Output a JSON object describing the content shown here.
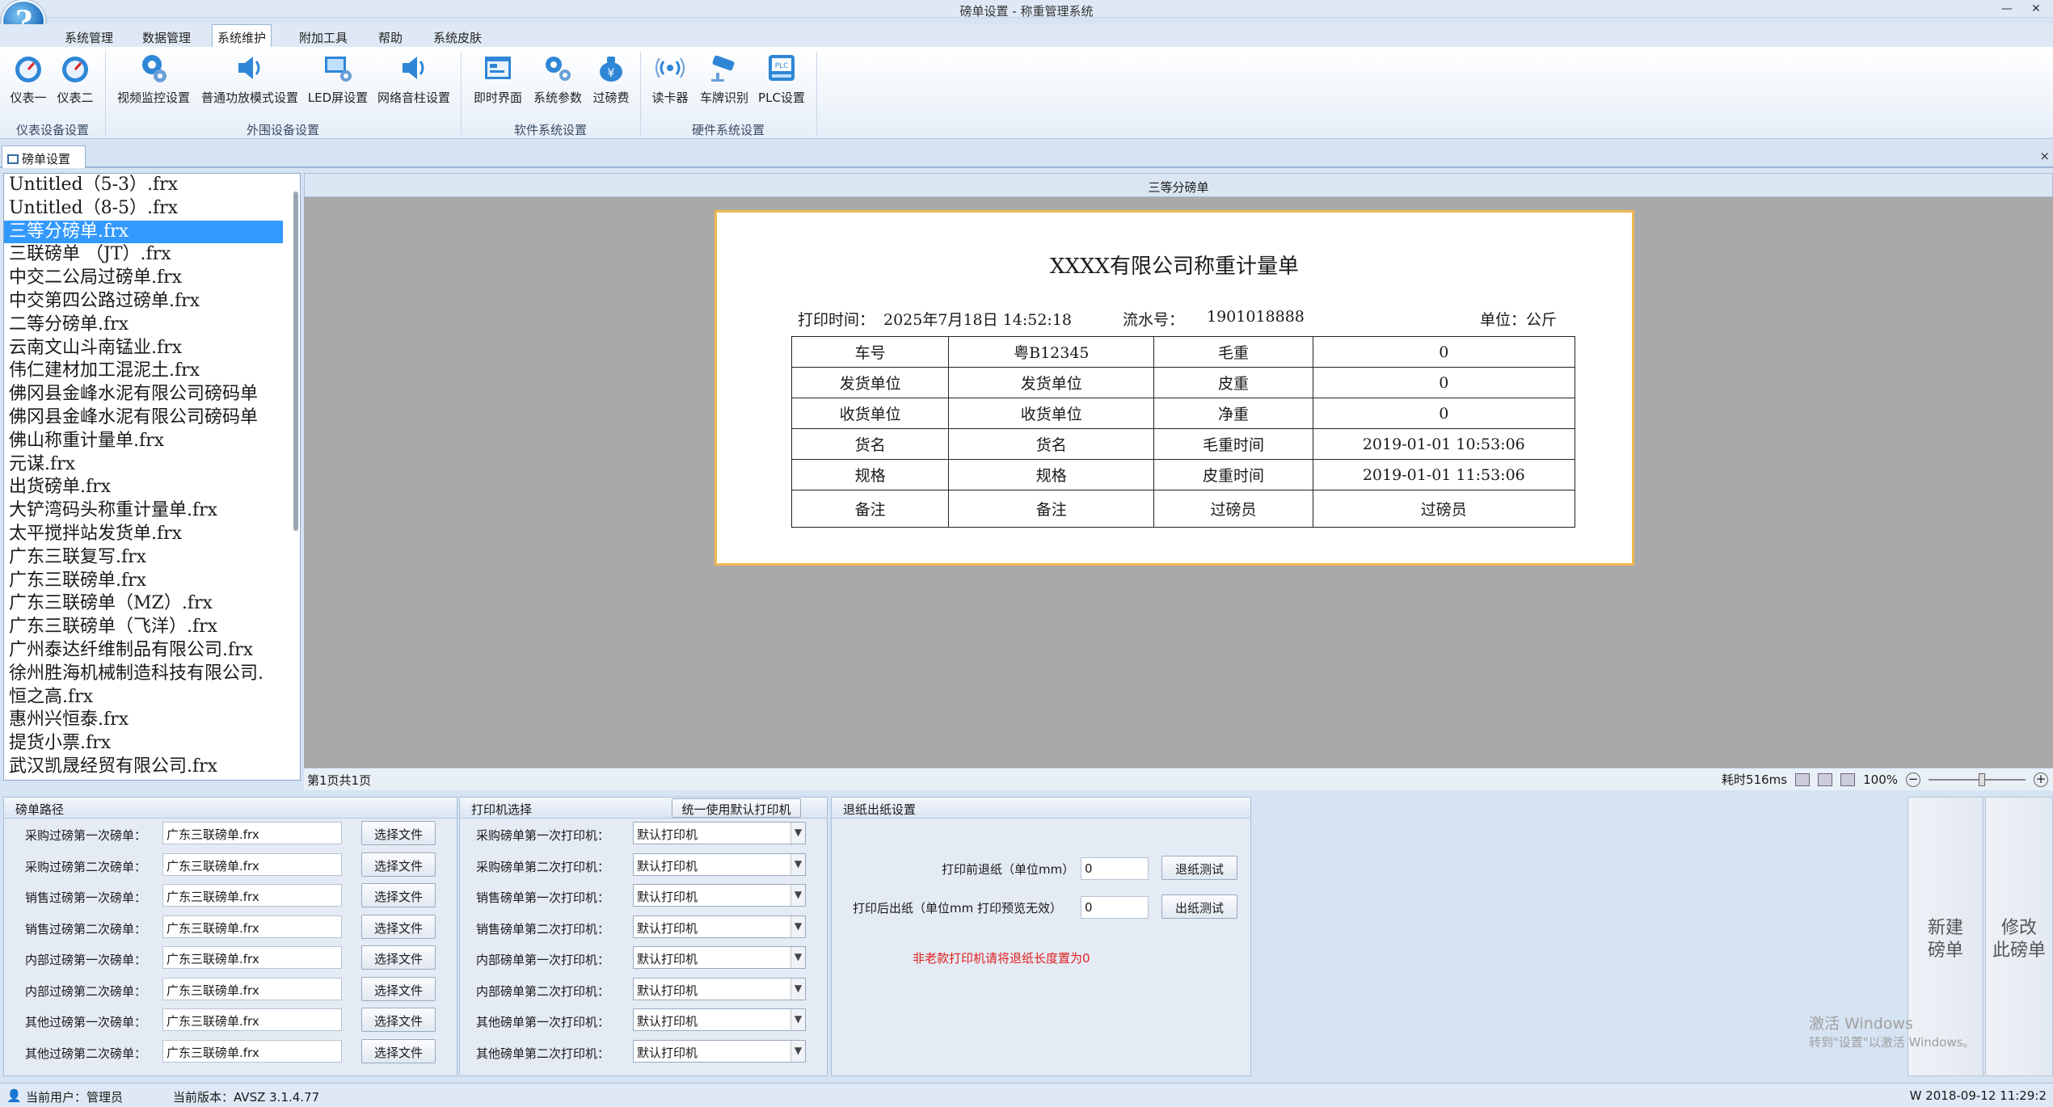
{
  "window": {
    "title": "磅单设置 - 称重管理系统",
    "min": "—",
    "close": "✕"
  },
  "menu": [
    "系统管理",
    "数据管理",
    "系统维护",
    "附加工具",
    "帮助",
    "系统皮肤"
  ],
  "ribbon": {
    "groups": [
      {
        "title": "仪表设备设置",
        "buttons": [
          {
            "label": "仪表一",
            "icon": "gauge-icon"
          },
          {
            "label": "仪表二",
            "icon": "gauge-icon"
          }
        ]
      },
      {
        "title": "外围设备设置",
        "buttons": [
          {
            "label": "视频监控设置",
            "icon": "camera-gear-icon"
          },
          {
            "label": "普通功放模式设置",
            "icon": "speaker-icon"
          },
          {
            "label": "LED屏设置",
            "icon": "led-screen-icon"
          },
          {
            "label": "网络音柱设置",
            "icon": "speaker-icon"
          }
        ]
      },
      {
        "title": "软件系统设置",
        "buttons": [
          {
            "label": "即时界面",
            "icon": "window-icon"
          },
          {
            "label": "系统参数",
            "icon": "gears-icon"
          },
          {
            "label": "过磅费",
            "icon": "money-bag-icon"
          }
        ]
      },
      {
        "title": "硬件系统设置",
        "buttons": [
          {
            "label": "读卡器",
            "icon": "card-reader-icon"
          },
          {
            "label": "车牌识别",
            "icon": "cctv-icon"
          },
          {
            "label": "PLC设置",
            "icon": "plc-icon"
          }
        ]
      }
    ]
  },
  "doc_tab": {
    "label": "磅单设置",
    "close": "×"
  },
  "files": [
    "Untitled（5-3）.frx",
    "Untitled（8-5）.frx",
    "三等分磅单.frx",
    "三联磅单 （JT）.frx",
    "中交二公局过磅单.frx",
    "中交第四公路过磅单.frx",
    "二等分磅单.frx",
    "云南文山斗南锰业.frx",
    "伟仁建材加工混泥土.frx",
    "佛冈县金峰水泥有限公司磅码单",
    "佛冈县金峰水泥有限公司磅码单",
    "佛山称重计量单.frx",
    "元谋.frx",
    "出货磅单.frx",
    "大铲湾码头称重计量单.frx",
    "太平搅拌站发货单.frx",
    "广东三联复写.frx",
    "广东三联磅单.frx",
    "广东三联磅单（MZ）.frx",
    "广东三联磅单（飞洋）.frx",
    "广州泰达纤维制品有限公司.frx",
    "徐州胜海机械制造科技有限公司.",
    "恒之高.frx",
    "惠州兴恒泰.frx",
    "提货小票.frx",
    "武汉凯晟经贸有限公司.frx"
  ],
  "selected_file_index": 2,
  "preview": {
    "header": "三等分磅单",
    "doc_title": "XXXX有限公司称重计量单",
    "print_time_label": "打印时间：",
    "print_time": "2025年7月18日  14:52:18",
    "serial_label": "流水号：",
    "serial": "1901018888",
    "unit_label": "单位：公斤",
    "rows": [
      [
        "车号",
        "粤B12345",
        "毛重",
        "0"
      ],
      [
        "发货单位",
        "发货单位",
        "皮重",
        "0"
      ],
      [
        "收货单位",
        "收货单位",
        "净重",
        "0"
      ],
      [
        "货名",
        "货名",
        "毛重时间",
        "2019-01-01 10:53:06"
      ],
      [
        "规格",
        "规格",
        "皮重时间",
        "2019-01-01 11:53:06"
      ],
      [
        "备注",
        "备注",
        "过磅员",
        "过磅员"
      ]
    ],
    "page_info": "第1页共1页",
    "elapsed": "耗时516ms",
    "zoom": "100%"
  },
  "path_panel": {
    "title": "磅单路径",
    "button_label": "选择文件",
    "rows": [
      {
        "label": "采购过磅第一次磅单：",
        "value": "广东三联磅单.frx"
      },
      {
        "label": "采购过磅第二次磅单：",
        "value": "广东三联磅单.frx"
      },
      {
        "label": "销售过磅第一次磅单：",
        "value": "广东三联磅单.frx"
      },
      {
        "label": "销售过磅第二次磅单：",
        "value": "广东三联磅单.frx"
      },
      {
        "label": "内部过磅第一次磅单：",
        "value": "广东三联磅单.frx"
      },
      {
        "label": "内部过磅第二次磅单：",
        "value": "广东三联磅单.frx"
      },
      {
        "label": "其他过磅第一次磅单：",
        "value": "广东三联磅单.frx"
      },
      {
        "label": "其他过磅第二次磅单：",
        "value": "广东三联磅单.frx"
      }
    ]
  },
  "printer_panel": {
    "title": "打印机选择",
    "default_button": "统一使用默认打印机",
    "rows": [
      {
        "label": "采购磅单第一次打印机：",
        "value": "默认打印机"
      },
      {
        "label": "采购磅单第二次打印机：",
        "value": "默认打印机"
      },
      {
        "label": "销售磅单第一次打印机：",
        "value": "默认打印机"
      },
      {
        "label": "销售磅单第二次打印机：",
        "value": "默认打印机"
      },
      {
        "label": "内部磅单第一次打印机：",
        "value": "默认打印机"
      },
      {
        "label": "内部磅单第二次打印机：",
        "value": "默认打印机"
      },
      {
        "label": "其他磅单第一次打印机：",
        "value": "默认打印机"
      },
      {
        "label": "其他磅单第二次打印机：",
        "value": "默认打印机"
      }
    ]
  },
  "paper_panel": {
    "title": "退纸出纸设置",
    "retreat_label": "打印前退纸（单位mm）",
    "retreat_value": "0",
    "retreat_test": "退纸测试",
    "feed_label": "打印后出纸（单位mm 打印预览无效）",
    "feed_value": "0",
    "feed_test": "出纸测试",
    "warning": "非老款打印机请将退纸长度置为0",
    "warning_color": "#e02020"
  },
  "actions": {
    "new_line1": "新建",
    "new_line2": "磅单",
    "edit_line1": "修改",
    "edit_line2": "此磅单"
  },
  "watermark": {
    "line1": "激活 Windows",
    "line2": "转到\"设置\"以激活 Windows。"
  },
  "statusbar": {
    "user": "当前用户：管理员",
    "version": "当前版本：AVSZ 3.1.4.77",
    "right": "W   2018-09-12 11:29:2"
  }
}
